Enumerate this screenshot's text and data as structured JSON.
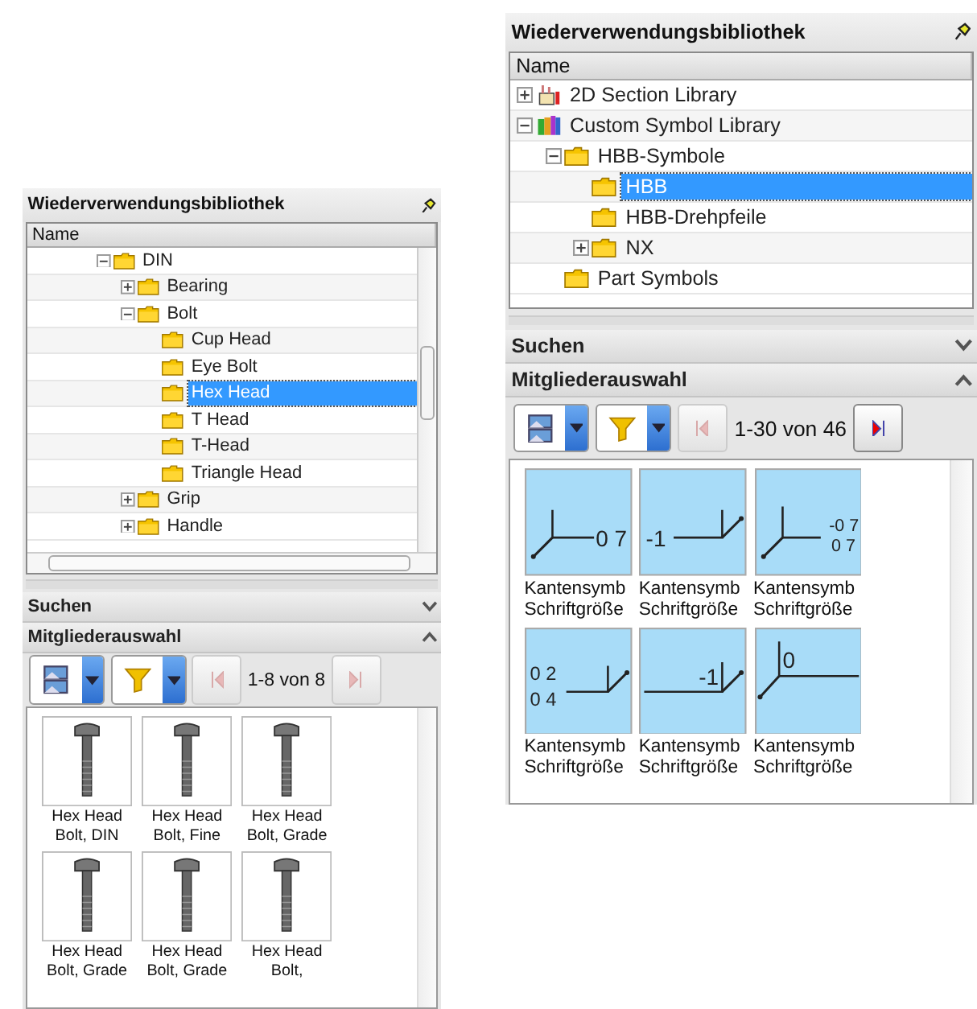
{
  "panels": [
    {
      "title": "Wiederverwendungsbibliothek",
      "tree": {
        "column": "Name",
        "nodes": [
          {
            "label": "DIN",
            "kind": "folder",
            "expanded": true,
            "selected": false,
            "children": [
              {
                "label": "Bearing",
                "kind": "folder",
                "expanded": false,
                "selected": false
              },
              {
                "label": "Bolt",
                "kind": "folder",
                "expanded": true,
                "selected": false,
                "children": [
                  {
                    "label": "Cup Head",
                    "kind": "folder",
                    "selected": false
                  },
                  {
                    "label": "Eye Bolt",
                    "kind": "folder",
                    "selected": false
                  },
                  {
                    "label": "Hex Head",
                    "kind": "folder",
                    "selected": true
                  },
                  {
                    "label": "T Head",
                    "kind": "folder",
                    "selected": false
                  },
                  {
                    "label": "T-Head",
                    "kind": "folder",
                    "selected": false
                  },
                  {
                    "label": "Triangle Head",
                    "kind": "folder",
                    "selected": false
                  }
                ]
              },
              {
                "label": "Grip",
                "kind": "folder",
                "expanded": false,
                "selected": false
              },
              {
                "label": "Handle",
                "kind": "folder",
                "expanded": false,
                "selected": false
              }
            ]
          }
        ]
      },
      "sections": [
        {
          "label": "Suchen",
          "expanded": false
        },
        {
          "label": "Mitgliederauswahl",
          "expanded": true
        }
      ],
      "pager": {
        "range": "1-8 von 8",
        "prev_enabled": false,
        "next_enabled": false
      },
      "members": [
        {
          "label": "Hex Head\nBolt, DIN",
          "kind": "bolt"
        },
        {
          "label": "Hex Head\nBolt, Fine",
          "kind": "bolt"
        },
        {
          "label": "Hex Head\nBolt, Grade",
          "kind": "bolt"
        },
        {
          "label": "Hex Head\nBolt, Grade",
          "kind": "bolt"
        },
        {
          "label": "Hex Head\nBolt, Grade",
          "kind": "bolt"
        },
        {
          "label": "Hex Head\nBolt,",
          "kind": "bolt"
        }
      ]
    },
    {
      "title": "Wiederverwendungsbibliothek",
      "tree": {
        "column": "Name",
        "nodes": [
          {
            "label": "2D Section Library",
            "kind": "section-library",
            "expanded": false,
            "selected": false
          },
          {
            "label": "Custom Symbol Library",
            "kind": "symbol-library",
            "expanded": true,
            "selected": false,
            "children": [
              {
                "label": "HBB-Symbole",
                "kind": "folder",
                "expanded": true,
                "selected": false,
                "children": [
                  {
                    "label": "HBB",
                    "kind": "folder",
                    "selected": true
                  },
                  {
                    "label": "HBB-Drehpfeile",
                    "kind": "folder",
                    "selected": false
                  },
                  {
                    "label": "NX",
                    "kind": "folder",
                    "expanded": false,
                    "selected": false
                  }
                ]
              },
              {
                "label": "Part Symbols",
                "kind": "folder",
                "selected": false
              }
            ]
          }
        ]
      },
      "sections": [
        {
          "label": "Suchen",
          "expanded": false
        },
        {
          "label": "Mitgliederauswahl",
          "expanded": true
        }
      ],
      "pager": {
        "range": "1-30 von 46",
        "prev_enabled": false,
        "next_enabled": true
      },
      "members": [
        {
          "label": "Kantensymb\nSchriftgröße",
          "kind": "corner-left",
          "texts": [
            "0 7"
          ]
        },
        {
          "label": "Kantensymb\nSchriftgröße",
          "kind": "corner-right",
          "texts": [
            "-1"
          ]
        },
        {
          "label": "Kantensymb\nSchriftgröße",
          "kind": "corner-left-stacked",
          "texts": [
            "-0 7",
            "0 7"
          ]
        },
        {
          "label": "Kantensymb\nSchriftgröße",
          "kind": "corner-right-stacked",
          "texts": [
            "0 2",
            "0 4"
          ]
        },
        {
          "label": "Kantensymb\nSchriftgröße",
          "kind": "line-right",
          "texts": [
            "-1"
          ]
        },
        {
          "label": "Kantensymb\nSchriftgröße",
          "kind": "flag-left",
          "texts": [
            "0"
          ]
        }
      ]
    }
  ]
}
